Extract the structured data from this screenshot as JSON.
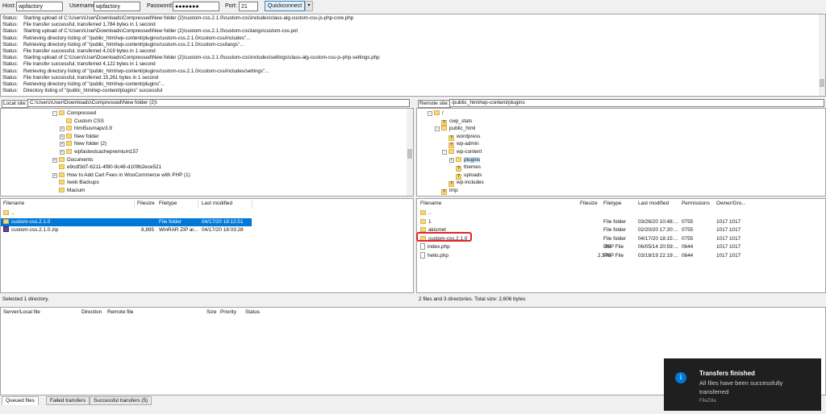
{
  "quickconnect": {
    "host_label": "Host:",
    "host_value": "wpfactory",
    "username_label": "Username:",
    "username_value": "wpfactory",
    "password_label": "Password:",
    "password_value": "●●●●●●●",
    "port_label": "Port:",
    "port_value": "21",
    "button_label": "Quickconnect",
    "dropdown_label": "▾"
  },
  "log": [
    {
      "status": "Status:",
      "text": "Starting upload of C:\\Users\\User\\Downloads\\Compressed\\New folder (2)\\custom-css.2.1.0\\custom-css\\includes\\class-alg-custom-css-js-php-core.php"
    },
    {
      "status": "Status:",
      "text": "File transfer successful, transferred 1,784 bytes in 1 second"
    },
    {
      "status": "Status:",
      "text": "Starting upload of C:\\Users\\User\\Downloads\\Compressed\\New folder (2)\\custom-css.2.1.0\\custom-css\\langs\\custom-css.pot"
    },
    {
      "status": "Status:",
      "text": "Retrieving directory listing of \"/public_html/wp-content/plugins/custom-css.2.1.0/custom-css/includes\"..."
    },
    {
      "status": "Status:",
      "text": "Retrieving directory listing of \"/public_html/wp-content/plugins/custom-css.2.1.0/custom-css/langs\"..."
    },
    {
      "status": "Status:",
      "text": "File transfer successful, transferred 4,019 bytes in 1 second"
    },
    {
      "status": "Status:",
      "text": "Starting upload of C:\\Users\\User\\Downloads\\Compressed\\New folder (2)\\custom-css.2.1.0\\custom-css\\includes\\settings\\class-alg-custom-css-js-php-settings.php"
    },
    {
      "status": "Status:",
      "text": "File transfer successful, transferred 4,122 bytes in 1 second"
    },
    {
      "status": "Status:",
      "text": "Retrieving directory listing of \"/public_html/wp-content/plugins/custom-css.2.1.0/custom-css/includes/settings\"..."
    },
    {
      "status": "Status:",
      "text": "File transfer successful, transferred 15,261 bytes in 1 second"
    },
    {
      "status": "Status:",
      "text": "Retrieving directory listing of \"/public_html/wp-content/plugins\"..."
    },
    {
      "status": "Status:",
      "text": "Directory listing of \"/public_html/wp-content/plugins\" successful"
    }
  ],
  "local": {
    "site_label": "Local site:",
    "site_path": "C:\\Users\\User\\Downloads\\Compressed\\New folder (2)\\",
    "tree": [
      {
        "label": "Compressed",
        "indent": 0,
        "exp": "-"
      },
      {
        "label": "Custom CSS",
        "indent": 1,
        "exp": ""
      },
      {
        "label": "html5usmapv3.9",
        "indent": 1,
        "exp": "+"
      },
      {
        "label": "New folder",
        "indent": 1,
        "exp": "+"
      },
      {
        "label": "New folder (2)",
        "indent": 1,
        "exp": "+"
      },
      {
        "label": "wpfastestcachepremium157",
        "indent": 1,
        "exp": "+"
      },
      {
        "label": "Documents",
        "indent": 0,
        "exp": "+"
      },
      {
        "label": "e9cdf3d7-6211-4f80-9c48-d109b2ece521",
        "indent": 0,
        "exp": ""
      },
      {
        "label": "How to Add Cart Fees in WooCommerce with PHP (1)",
        "indent": 0,
        "exp": "+"
      },
      {
        "label": "Iweb Backups",
        "indent": 0,
        "exp": ""
      },
      {
        "label": "Macium",
        "indent": 0,
        "exp": ""
      }
    ],
    "headers": {
      "filename": "Filename",
      "filesize": "Filesize",
      "filetype": "Filetype",
      "modified": "Last modified"
    },
    "files": [
      {
        "name": "..",
        "size": "",
        "type": "",
        "modified": "",
        "icon": "folder"
      },
      {
        "name": "custom-css.2.1.0",
        "size": "",
        "type": "File folder",
        "modified": "04/17/20 18:12:51",
        "icon": "folder"
      },
      {
        "name": "custom-css.2.1.0.zip",
        "size": "8,895",
        "type": "WinRAR ZIP ar...",
        "modified": "04/17/20 18:03:28",
        "icon": "zip"
      }
    ],
    "status": "Selected 1 directory."
  },
  "remote": {
    "site_label": "Remote site:",
    "site_path": "/public_html/wp-content/plugins",
    "tree": [
      {
        "label": "/",
        "indent": 0,
        "exp": "-",
        "q": false
      },
      {
        "label": "cwp_stats",
        "indent": 1,
        "exp": "",
        "q": true
      },
      {
        "label": "public_html",
        "indent": 1,
        "exp": "-",
        "q": false
      },
      {
        "label": "wordpress",
        "indent": 2,
        "exp": "",
        "q": true
      },
      {
        "label": "wp-admin",
        "indent": 2,
        "exp": "",
        "q": true
      },
      {
        "label": "wp-content",
        "indent": 2,
        "exp": "-",
        "q": false
      },
      {
        "label": "plugins",
        "indent": 3,
        "exp": "+",
        "q": false
      },
      {
        "label": "themes",
        "indent": 3,
        "exp": "",
        "q": true
      },
      {
        "label": "uploads",
        "indent": 3,
        "exp": "",
        "q": true
      },
      {
        "label": "wp-includes",
        "indent": 2,
        "exp": "",
        "q": true
      },
      {
        "label": "tmp",
        "indent": 1,
        "exp": "",
        "q": true
      }
    ],
    "headers": {
      "filename": "Filename",
      "filesize": "Filesize",
      "filetype": "Filetype",
      "modified": "Last modified",
      "permissions": "Permissions",
      "owner": "Owner/Gro..."
    },
    "files": [
      {
        "name": "..",
        "size": "",
        "type": "",
        "modified": "",
        "perm": "",
        "owner": "",
        "icon": "folder"
      },
      {
        "name": "1",
        "size": "",
        "type": "File folder",
        "modified": "03/26/20 10:48:...",
        "perm": "0755",
        "owner": "1017 1017",
        "icon": "folder"
      },
      {
        "name": "akismet",
        "size": "",
        "type": "File folder",
        "modified": "02/20/20 17:20:...",
        "perm": "0755",
        "owner": "1017 1017",
        "icon": "folder"
      },
      {
        "name": "custom-css.2.1.0",
        "size": "",
        "type": "File folder",
        "modified": "04/17/20 18:15:...",
        "perm": "0755",
        "owner": "1017 1017",
        "icon": "folder"
      },
      {
        "name": "index.php",
        "size": "28",
        "type": "PHP File",
        "modified": "06/05/14 20:59:...",
        "perm": "0644",
        "owner": "1017 1017",
        "icon": "file"
      },
      {
        "name": "hello.php",
        "size": "2,578",
        "type": "PHP File",
        "modified": "03/18/19 22:19:...",
        "perm": "0644",
        "owner": "1017 1017",
        "icon": "file"
      }
    ],
    "status": "2 files and 3 directories. Total size: 2,606 bytes"
  },
  "queue": {
    "headers": {
      "server": "Server/Local file",
      "direction": "Direction",
      "remote": "Remote file",
      "size": "Size",
      "priority": "Priority",
      "status": "Status"
    },
    "tabs": [
      "Queued files",
      "Failed transfers",
      "Successful transfers (5)"
    ]
  },
  "toast": {
    "title": "Transfers finished",
    "body": "All files have been successfully transferred",
    "app": "FileZilla",
    "icon": "i"
  }
}
